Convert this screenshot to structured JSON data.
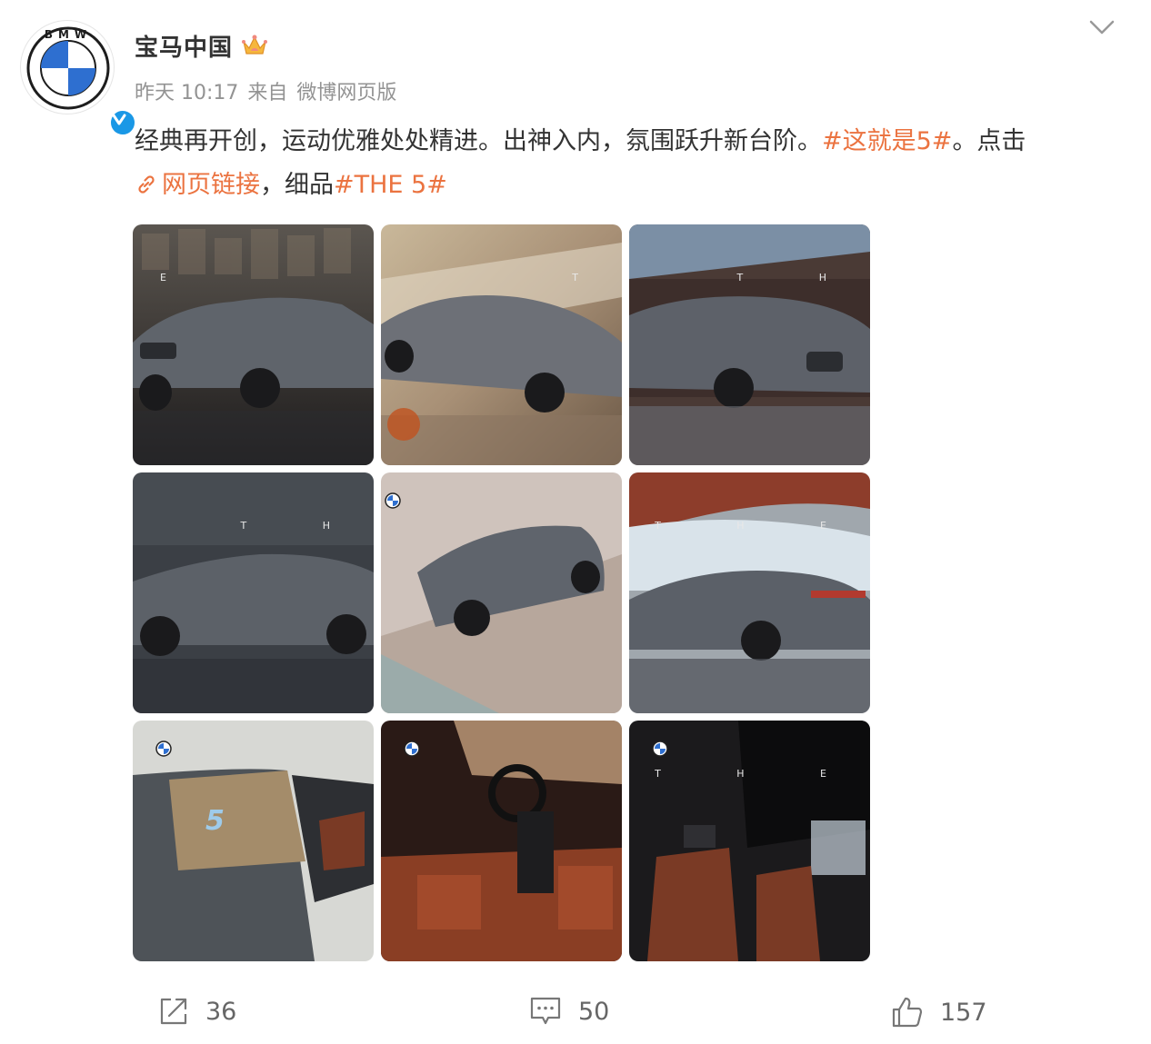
{
  "post": {
    "author": "宝马中国",
    "time": "昨天 10:17",
    "source_prefix": "来自",
    "source": "微博网页版",
    "text": {
      "part1": "经典再开创，运动优雅处处精进。出神入内，氛围跃升新台阶。",
      "tag1": "#这就是5#",
      "part2": "。点击",
      "link": "网页链接",
      "part3": "，细品",
      "tag2": "#THE 5#"
    },
    "avatar_letters": "BMW",
    "image_letters": [
      "E",
      "T",
      "T H",
      "T H",
      "",
      "T H E",
      "",
      "",
      "T H E"
    ]
  },
  "actions": {
    "repost_count": "36",
    "comment_count": "50",
    "like_count": "157"
  },
  "icons": {
    "verified": "verified-badge-icon",
    "crown": "crown-icon",
    "chevron": "chevron-down-icon",
    "link": "link-icon",
    "repost": "repost-icon",
    "comment": "comment-icon",
    "like": "thumbs-up-icon"
  },
  "colors": {
    "accent": "#eb7340",
    "verified": "#1a98e6",
    "meta": "#939393",
    "bmw_blue": "#2e6fd0"
  }
}
